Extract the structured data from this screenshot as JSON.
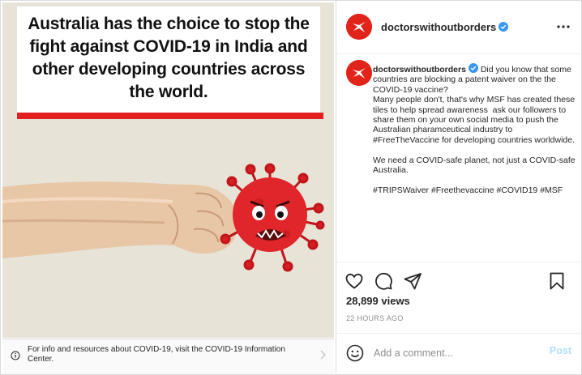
{
  "post_image": {
    "headline": "Australia has the choice to stop the fight against COVID-19 in India and other developing countries across the world."
  },
  "info_banner": {
    "text": "For info and resources about COVID-19, visit the COVID-19 Information Center.",
    "icon": "info-icon"
  },
  "header": {
    "username": "doctorswithoutborders",
    "verified": true,
    "more_icon": "more-icon"
  },
  "caption": {
    "username": "doctorswithoutborders",
    "text": " Did you know that some countries are blocking a patent waiver on the the COVID-19 vaccine?\nMany people don't, that's why MSF has created these tiles to help spread awareness  ask our followers to share them on your own social media to push the Australian pharamceutical industry to #FreeTheVaccine for developing countries worldwide.\n\nWe need a COVID-safe planet, not just a COVID-safe Australia.\n\n#TRIPSWaiver #Freethevaccine #COVID19 #MSF"
  },
  "actions": {
    "icons": [
      "heart-icon",
      "comment-icon",
      "share-icon",
      "bookmark-icon"
    ]
  },
  "stats": {
    "views": "28,899 views",
    "time": "22 HOURS AGO"
  },
  "comment_box": {
    "placeholder": "Add a comment...",
    "post_label": "Post"
  },
  "colors": {
    "brand_red": "#e2231a",
    "verified_blue": "#3897f0",
    "post_disabled": "#b2dffc",
    "image_background": "#e7e4d7"
  }
}
